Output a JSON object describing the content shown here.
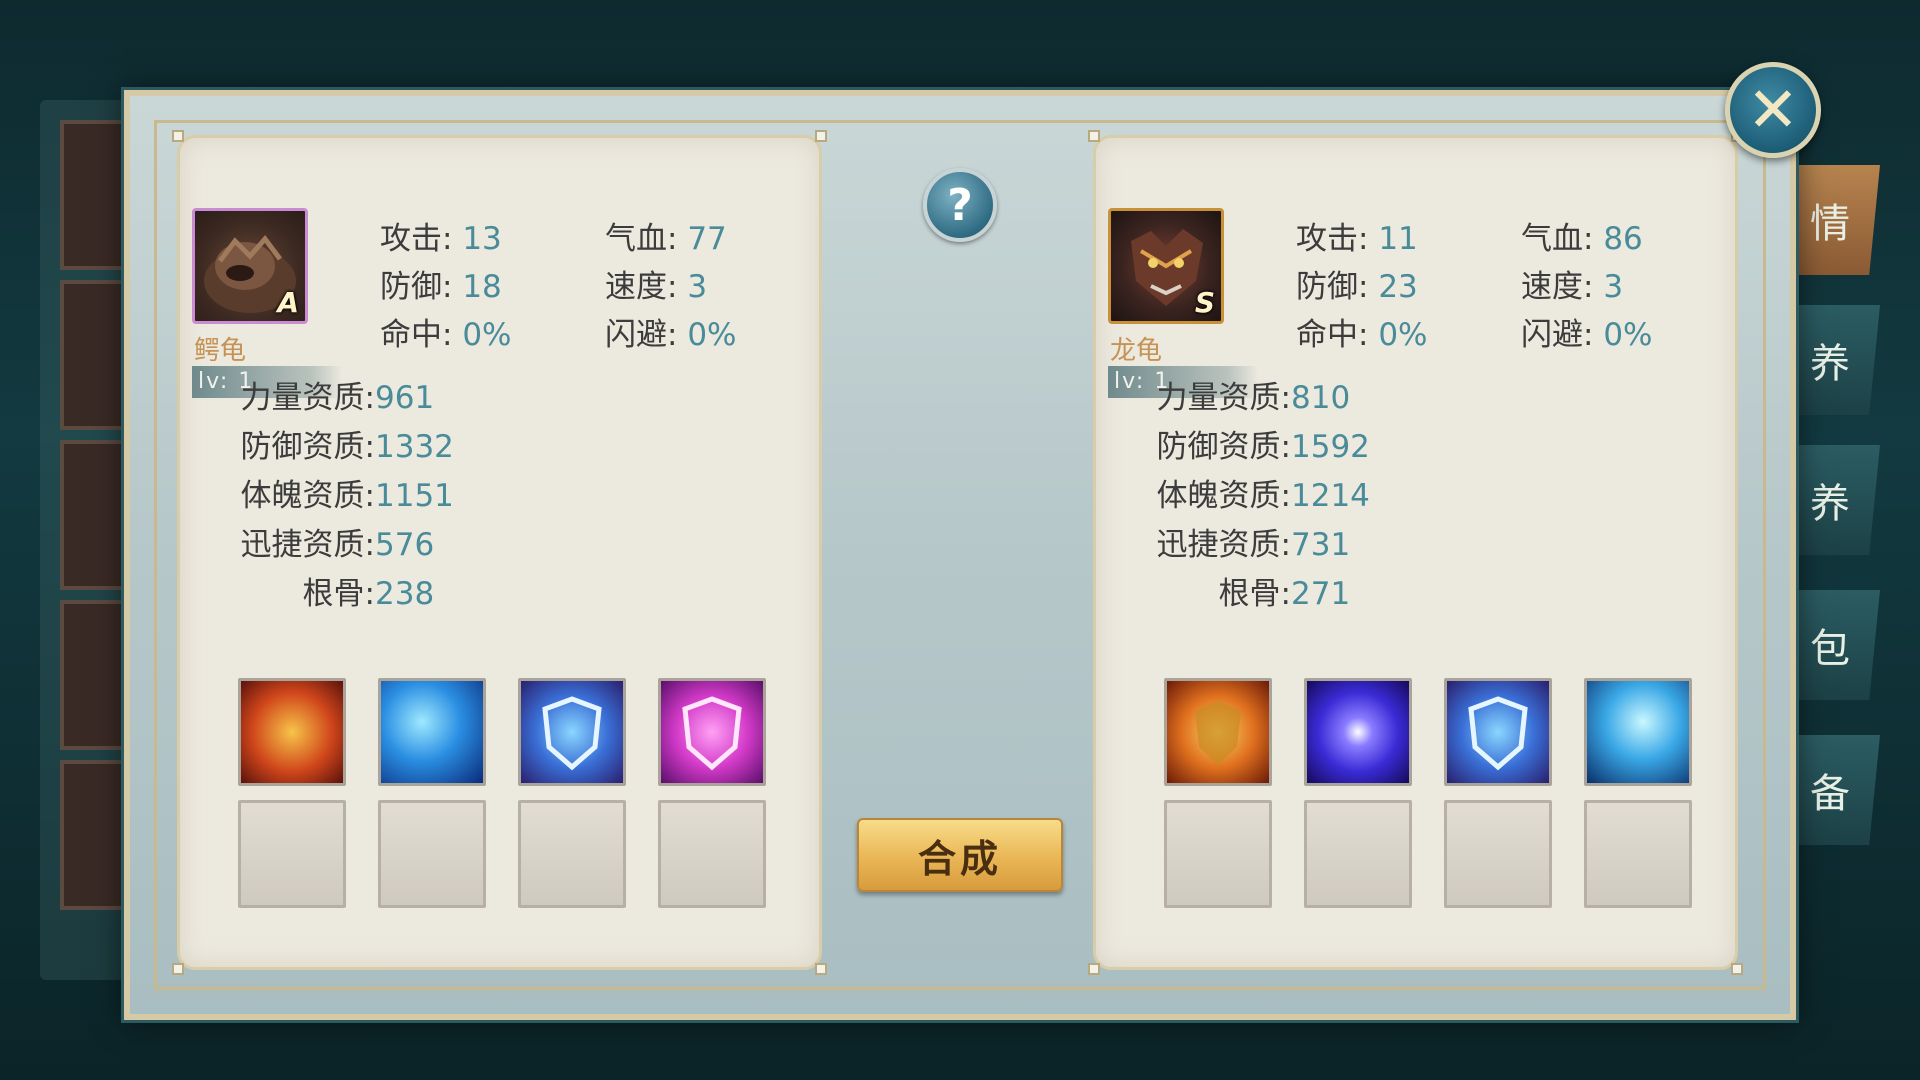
{
  "left_pet": {
    "name": "鳄龟",
    "grade": "A",
    "level": "lv: 1",
    "stats": [
      {
        "label": "攻击:",
        "value": "13"
      },
      {
        "label": "气血:",
        "value": "77"
      },
      {
        "label": "防御:",
        "value": "18"
      },
      {
        "label": "速度:",
        "value": "3"
      },
      {
        "label": "命中:",
        "value": "0%"
      },
      {
        "label": "闪避:",
        "value": "0%"
      }
    ],
    "aptitudes": [
      {
        "label": "力量资质:",
        "value": "961"
      },
      {
        "label": "防御资质:",
        "value": "1332"
      },
      {
        "label": "体魄资质:",
        "value": "1151"
      },
      {
        "label": "迅捷资质:",
        "value": "576"
      },
      {
        "label": "根骨:",
        "value": "238"
      }
    ],
    "skills": [
      "turtle-fire-ring-skill-icon",
      "blue-flame-skill-icon",
      "blue-shield-skill-icon",
      "pink-shield-skill-icon"
    ]
  },
  "right_pet": {
    "name": "龙龟",
    "grade": "S",
    "level": "lv: 1",
    "stats": [
      {
        "label": "攻击:",
        "value": "11"
      },
      {
        "label": "气血:",
        "value": "86"
      },
      {
        "label": "防御:",
        "value": "23"
      },
      {
        "label": "速度:",
        "value": "3"
      },
      {
        "label": "命中:",
        "value": "0%"
      },
      {
        "label": "闪避:",
        "value": "0%"
      }
    ],
    "aptitudes": [
      {
        "label": "力量资质:",
        "value": "810"
      },
      {
        "label": "防御资质:",
        "value": "1592"
      },
      {
        "label": "体魄资质:",
        "value": "1214"
      },
      {
        "label": "迅捷资质:",
        "value": "731"
      },
      {
        "label": "根骨:",
        "value": "271"
      }
    ],
    "skills": [
      "fire-shield-skill-icon",
      "purple-orb-skill-icon",
      "blue-shield-skill-icon",
      "ice-burst-skill-icon"
    ]
  },
  "center": {
    "help_label": "?",
    "combine_label": "合成"
  },
  "side_tabs": [
    "情",
    "养",
    "养",
    "包",
    "备"
  ],
  "close_label": "✕",
  "colors": {
    "stat_value": "#4a8b9a",
    "combine_button": "#e9b655",
    "frame_accent": "#d6c9a6"
  }
}
